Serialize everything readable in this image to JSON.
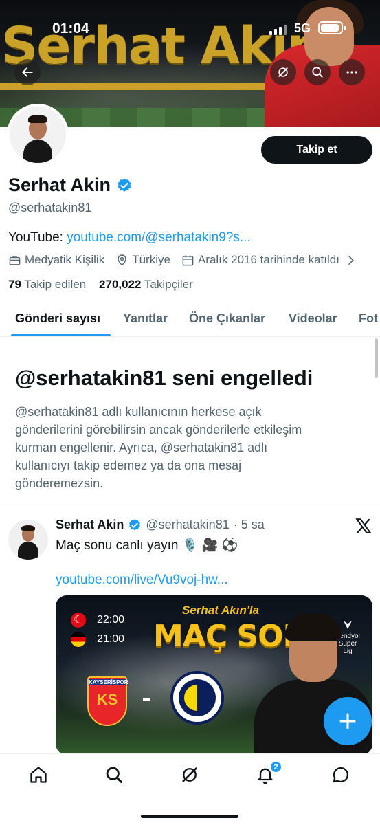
{
  "status_bar": {
    "time": "01:04",
    "network": "5G"
  },
  "banner": {
    "title": "Serhat Akın"
  },
  "profile": {
    "follow_label": "Takip et",
    "name": "Serhat Akin",
    "handle": "@serhatakin81",
    "bio_prefix": "YouTube:",
    "bio_link": "youtube.com/@serhatakin9?s...",
    "category": "Medyatik Kişilik",
    "location": "Türkiye",
    "joined": "Aralık 2016 tarihinde katıldı",
    "following_count": "79",
    "following_label": "Takip edilen",
    "followers_count": "270,022",
    "followers_label": "Takipçiler"
  },
  "tabs": [
    "Gönderi sayısı",
    "Yanıtlar",
    "Öne Çıkanlar",
    "Videolar",
    "Fot"
  ],
  "blocked": {
    "title": "@serhatakin81 seni engelledi",
    "text": "@serhatakin81 adlı kullanıcının herkese açık gönderilerini görebilirsin ancak gönderilerle etkileşim kurman engellenir. Ayrıca, @serhatakin81 adlı kullanıcıyı takip edemez ya da ona mesaj gönderemezsin."
  },
  "tweet": {
    "name": "Serhat Akin",
    "handle": "@serhatakin81",
    "time": "· 5 sa",
    "text": "Maç sonu canlı yayın 🎙️ 🎥 ⚽",
    "link": "youtube.com/live/Vu9voj-hw...",
    "media": {
      "time_tr": "22:00",
      "time_de": "21:00",
      "subtitle": "Serhat Akın'la",
      "headline": "MAÇ SONU",
      "league_line1": "trendyol",
      "league_line2": "Süper Lig",
      "team1_short": "KS",
      "team1_name": "KAYSERİSPOR"
    }
  },
  "notifications_count": "2",
  "colors": {
    "accent": "#1d9bf0",
    "text": "#0f1419",
    "muted": "#536471",
    "banner_gold": "#c9a227"
  },
  "icons": [
    "back-arrow-icon",
    "grok-icon",
    "search-icon",
    "more-icon",
    "verified-icon",
    "briefcase-icon",
    "location-icon",
    "calendar-icon",
    "chevron-right-icon",
    "x-logo-icon",
    "plus-icon",
    "home-icon",
    "explore-icon",
    "notifications-icon",
    "messages-icon"
  ]
}
